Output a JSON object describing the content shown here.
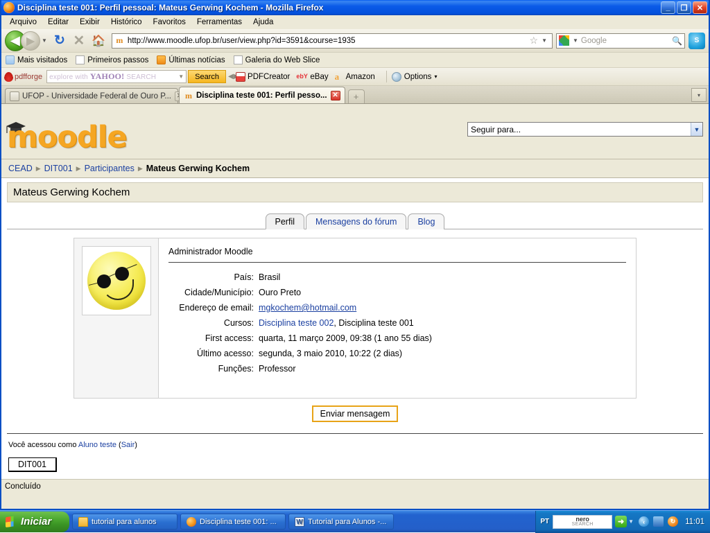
{
  "window": {
    "title": "Disciplina teste 001: Perfil pessoal: Mateus Gerwing Kochem - Mozilla Firefox",
    "minimize_label": "_",
    "maximize_label": "❐",
    "close_label": "✕"
  },
  "menubar": {
    "items": [
      {
        "label": "Arquivo"
      },
      {
        "label": "Editar"
      },
      {
        "label": "Exibir"
      },
      {
        "label": "Histórico"
      },
      {
        "label": "Favoritos"
      },
      {
        "label": "Ferramentas"
      },
      {
        "label": "Ajuda"
      }
    ]
  },
  "navbar": {
    "back_glyph": "◀",
    "forward_glyph": "▶",
    "history_caret": "▼",
    "reload_glyph": "↻",
    "stop_glyph": "✕",
    "home_glyph": "🏠",
    "url": "http://www.moodle.ufop.br/user/view.php?id=3591&course=1935",
    "url_favicon_letter": "m",
    "bookmark_star": "☆",
    "url_caret": "▼",
    "search_placeholder": "Google",
    "search_glyph": "🔍",
    "skype_label": "S"
  },
  "bookmarks": [
    {
      "label": "Mais visitados",
      "icon": "ico-blue"
    },
    {
      "label": "Primeiros passos",
      "icon": "ico-page"
    },
    {
      "label": "Últimas notícias",
      "icon": "ico-rss"
    },
    {
      "label": "Galeria do Web Slice",
      "icon": "ico-page"
    }
  ],
  "pdfforge_toolbar": {
    "brand": "pdfforge",
    "search_placeholder_pre": "explore with",
    "search_placeholder_brand": "YAHOO!",
    "search_placeholder_post": "SEARCH",
    "dropdown_caret": "▼",
    "search_button": "Search",
    "grip": "◀▶",
    "items": [
      {
        "label": "PDFCreator",
        "icon": "pdfico"
      },
      {
        "label": "eBay",
        "icon": "ebayico",
        "icon_text": "ebY"
      },
      {
        "label": "Amazon",
        "icon": "amzico",
        "icon_text": "a"
      }
    ],
    "options_label": "Options",
    "options_caret": "▾"
  },
  "browser_tabs": {
    "tabs": [
      {
        "label": "UFOP - Universidade Federal de Ouro P...",
        "active": false,
        "icon": "tico-doc",
        "close": "✕"
      },
      {
        "label": "Disciplina teste 001: Perfil pesso...",
        "active": true,
        "icon": "tico-m",
        "icon_text": "m",
        "close": "✕"
      }
    ],
    "new_tab_label": "+",
    "tab_list_label": "▾"
  },
  "moodle": {
    "logo_text": "moodle",
    "jump_menu": {
      "selected": "Seguir para...",
      "caret": "▼"
    },
    "breadcrumb": {
      "separator": "▶",
      "items": [
        {
          "label": "CEAD",
          "link": true
        },
        {
          "label": "DIT001",
          "link": true
        },
        {
          "label": "Participantes",
          "link": true
        },
        {
          "label": "Mateus Gerwing Kochem",
          "link": false
        }
      ]
    },
    "page_title": "Mateus Gerwing Kochem",
    "tabs": [
      {
        "label": "Perfil",
        "active": true
      },
      {
        "label": "Mensagens do fórum",
        "active": false
      },
      {
        "label": "Blog",
        "active": false
      }
    ],
    "profile": {
      "role_heading": "Administrador Moodle",
      "fields": [
        {
          "label": "País:",
          "value": "Brasil",
          "link": false
        },
        {
          "label": "Cidade/Município:",
          "value": "Ouro Preto",
          "link": false
        },
        {
          "label": "Endereço de email:",
          "value": "mgkochem@hotmail.com",
          "link": true
        },
        {
          "label": "Cursos:",
          "value_link": "Disciplina teste 002",
          "value_rest": ", Disciplina teste 001",
          "link": true
        },
        {
          "label": "First access:",
          "value": "quarta, 11 março 2009, 09:38  (1 ano 55 dias)",
          "link": false
        },
        {
          "label": "Último acesso:",
          "value": "segunda, 3 maio 2010, 10:22  (2 dias)",
          "link": false
        },
        {
          "label": "Funções:",
          "value": "Professor",
          "link": false
        }
      ]
    },
    "send_message_button": "Enviar mensagem",
    "footer": {
      "logged_in_pre": "Você acessou como ",
      "logged_in_user": "Aluno teste",
      "logout_open": " (",
      "logout_label": "Sair",
      "logout_close": ")",
      "home_button": "DIT001"
    }
  },
  "statusbar": {
    "text": "Concluído"
  },
  "taskbar": {
    "start_label": "Iniciar",
    "buttons": [
      {
        "label": "tutorial para alunos",
        "icon": "tbi-folder"
      },
      {
        "label": "Disciplina teste 001: ...",
        "icon": "tbi-ff"
      },
      {
        "label": "Tutorial para Alunos -...",
        "icon": "tbi-word",
        "icon_text": "W"
      }
    ],
    "tray": {
      "language": "PT",
      "nero_line1": "nero",
      "nero_line2": "SEARCH",
      "arrow_glyph": "➜",
      "caret": "▼",
      "icons": [
        {
          "name": "back-arrow",
          "glyph": "‹",
          "cls": "tc-blue"
        },
        {
          "name": "network",
          "glyph": "",
          "cls": "tc-net"
        },
        {
          "name": "update",
          "glyph": "↻",
          "cls": "tc-orange"
        }
      ],
      "clock": "11:01"
    }
  },
  "colors": {
    "titlebar_blue": "#0a5be8",
    "moodle_orange": "#f5a623",
    "link_blue": "#1a3fa0",
    "chrome_beige": "#ece9d8",
    "taskbar_blue": "#2263cf",
    "button_gold": "#e8a317"
  }
}
